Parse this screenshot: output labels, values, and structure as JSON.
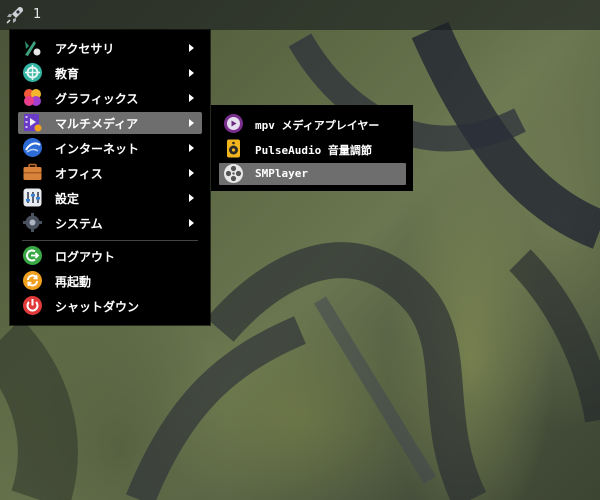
{
  "panel": {
    "workspace_label": "1",
    "launcher_icon": "rocket-icon"
  },
  "menu": {
    "items": [
      {
        "label": "アクセサリ",
        "icon": "accessories-icon",
        "submenu": true
      },
      {
        "label": "教育",
        "icon": "education-icon",
        "submenu": true
      },
      {
        "label": "グラフィックス",
        "icon": "graphics-icon",
        "submenu": true
      },
      {
        "label": "マルチメディア",
        "icon": "multimedia-icon",
        "submenu": true,
        "active": true
      },
      {
        "label": "インターネット",
        "icon": "internet-icon",
        "submenu": true
      },
      {
        "label": "オフィス",
        "icon": "office-icon",
        "submenu": true
      },
      {
        "label": "設定",
        "icon": "settings-icon",
        "submenu": true
      },
      {
        "label": "システム",
        "icon": "system-icon",
        "submenu": true
      },
      {
        "label": "ログアウト",
        "icon": "logout-icon",
        "submenu": false
      },
      {
        "label": "再起動",
        "icon": "restart-icon",
        "submenu": false
      },
      {
        "label": "シャットダウン",
        "icon": "shutdown-icon",
        "submenu": false
      }
    ]
  },
  "submenu": {
    "items": [
      {
        "label": "mpv メディアプレイヤー",
        "icon": "mpv-icon"
      },
      {
        "label": "PulseAudio 音量調節",
        "icon": "speaker-icon"
      },
      {
        "label": "SMPlayer",
        "icon": "film-reel-icon",
        "active": true
      }
    ]
  },
  "colors": {
    "menu_bg": "#000000",
    "highlight": "#6e6e6e",
    "text": "#ffffff"
  }
}
